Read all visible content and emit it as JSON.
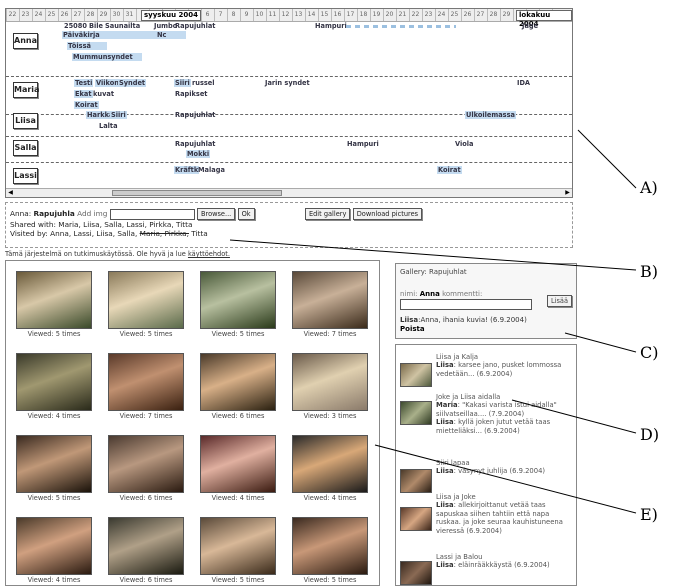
{
  "ruler": {
    "days": [
      "22",
      "23",
      "24",
      "25",
      "26",
      "27",
      "28",
      "29",
      "30",
      "31",
      "1",
      "2",
      "3",
      "4",
      "5",
      "6",
      "7",
      "8",
      "9",
      "10",
      "11",
      "12",
      "13",
      "14",
      "15",
      "16",
      "17",
      "18",
      "19",
      "20",
      "21",
      "22",
      "23",
      "24",
      "25",
      "26",
      "27",
      "28",
      "29",
      "30",
      "1",
      "2",
      "3"
    ],
    "months": [
      "syyskuu 2004",
      "lokakuu 2004"
    ]
  },
  "lanes": [
    {
      "name": "Anna",
      "events": [
        "25080",
        "Bile",
        "Saunailta",
        "Jumbo",
        "Rapujuhlat",
        "Hampuri",
        "Jäge",
        "Päiväkirja",
        "Nc",
        "Töissä",
        "Mummunsyndet"
      ]
    },
    {
      "name": "Maria",
      "events": [
        "Testi",
        "Viikon",
        "Syndet",
        "Siiri",
        "russel",
        "Jarin syndet",
        "IDA",
        "Ekat",
        "kuvat",
        "Rapikset",
        "Koirat"
      ]
    },
    {
      "name": "Liisa",
      "events": [
        "Harkka",
        "Siiri",
        "Rapujuhlat",
        "Ulkoilemassa",
        "Lalta"
      ]
    },
    {
      "name": "Salla",
      "events": [
        "Rapujuhlat",
        "Hampuri",
        "Viola",
        "Mokki"
      ]
    },
    {
      "name": "Lassi",
      "events": [
        "Kräftk",
        "Malaga",
        "Koirat"
      ]
    }
  ],
  "info": {
    "owner": "Anna:",
    "gallery": "Rapujuhla",
    "add_img": "Add img",
    "browse": "Browse...",
    "ok": "Ok",
    "edit_gallery": "Edit gallery",
    "download": "Download pictures",
    "shared_with": "Shared with: Maria, Liisa, Salla, Lassi, Pirkka, Titta",
    "visited_prefix": "Visited by: Anna, Lassi, Liisa, Salla, ",
    "visited_struck": "Maria, Pirkka,",
    "visited_suffix": " Titta"
  },
  "notice": {
    "text": "Tämä järjestelmä on tutkimuskäytössä. Ole hyvä ja lue ",
    "link": "käyttöehdot."
  },
  "photos": [
    "Viewed: 5 times",
    "Viewed: 5 times",
    "Viewed: 5 times",
    "Viewed: 7 times",
    "Viewed: 4 times",
    "Viewed: 7 times",
    "Viewed: 6 times",
    "Viewed: 3 times",
    "Viewed: 5 times",
    "Viewed: 6 times",
    "Viewed: 4 times",
    "Viewed: 4 times",
    "Viewed: 4 times",
    "Viewed: 6 times",
    "Viewed: 5 times",
    "Viewed: 5 times"
  ],
  "gallery_box": {
    "title": "Gallery: Rapujuhlat",
    "name_label": "nimi:",
    "name_value": "Anna",
    "comment_label": "kommentti:",
    "save": "Lisää",
    "comment_author": "Liisa",
    "comment_text": ":Anna, ihania kuvia! (6.9.2004)",
    "delete": "Poista"
  },
  "comments": [
    {
      "title": "Liisa ja Kalja",
      "who": "Liisa",
      "text": ": karsee jano, pusket lommossa vedetään... (6.9.2004)"
    },
    {
      "title": "Joke ja   Liisa aidalla",
      "who": "Maria",
      "text": ": \"Kakasi varista istui aidalla\" siilvatseillaa.... (7.9.2004)",
      "who2": "Liisa",
      "text2": ": kyllä joken jutut vetää taas mietteliäksi... (6.9.2004)"
    },
    {
      "title": "Siiri lapaa",
      "who": "Liisa",
      "text": ": väsynyt juhlija (6.9.2004)"
    },
    {
      "title": "Liisa ja Joke",
      "who": "Liisa",
      "text": ": allekirjoittanut vetää taas sapuskaa siihen tahtiin että napa ruskaa. ja joke seuraa kauhistuneena vieressä (6.9.2004)"
    },
    {
      "title": "Lassi ja Balou",
      "who": "Liisa",
      "text": ": eläinrääkkäystä (6.9.2004)"
    }
  ],
  "callouts": [
    "A)",
    "B)",
    "C)",
    "D)",
    "E)"
  ]
}
